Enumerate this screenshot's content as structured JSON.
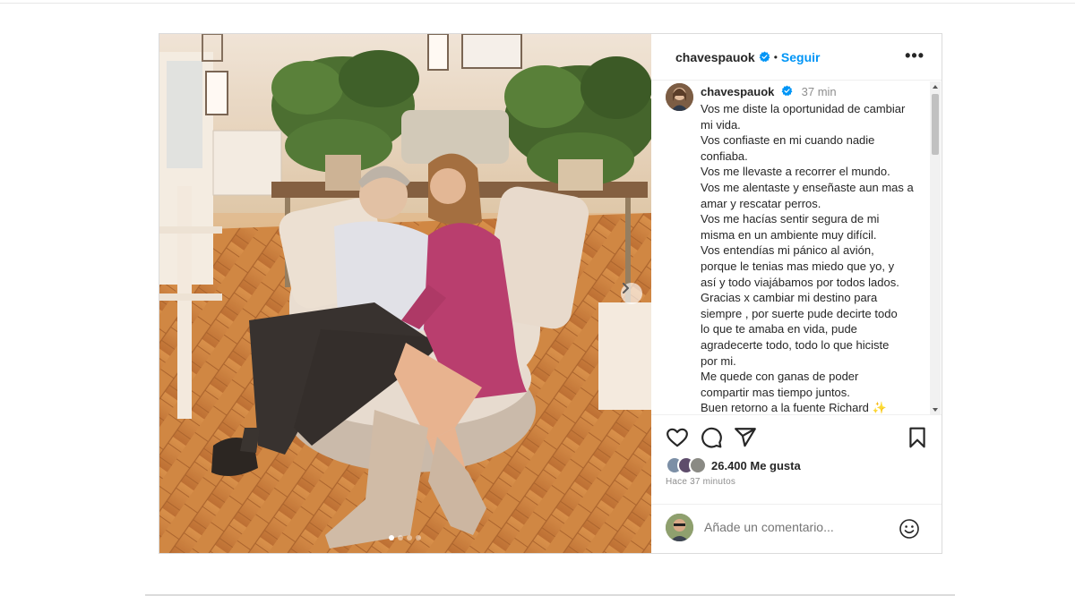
{
  "post": {
    "username": "chavespauok",
    "follow_label": "Seguir",
    "separator": "•",
    "more_label": "•••",
    "caption": {
      "username": "chavespauok",
      "time": "37 min",
      "lines": [
        "Vos me diste la oportunidad de cambiar",
        "mi vida.",
        "Vos confiaste en mi cuando nadie",
        "confiaba.",
        "Vos me llevaste a recorrer el mundo.",
        "Vos me alentaste y enseñaste aun mas a",
        "amar y rescatar perros.",
        "Vos me hacías sentir segura de mi",
        "misma en un ambiente muy difícil.",
        "Vos entendías mi pánico al avión,",
        "porque le tenias mas miedo que yo, y",
        "así y todo viajábamos por todos lados.",
        "Gracias x cambiar mi destino para",
        "siempre , por suerte pude decirte todo",
        "lo que te amaba en vida, pude",
        "agradecerte todo, todo lo que hiciste",
        "por mi.",
        "Me quede con ganas de poder",
        "compartir mas tiempo juntos.",
        "Buen retorno a la fuente Richard ✨"
      ]
    },
    "likes": "26.400 Me gusta",
    "posted_ago": "Hace 37 minutos",
    "comment_placeholder": "Añade un comentario...",
    "carousel": {
      "count": 4,
      "active_index": 0
    },
    "icons": {
      "more": "more-options-icon",
      "like": "heart-icon",
      "comment": "comment-icon",
      "share": "share-icon",
      "save": "bookmark-icon",
      "emoji": "emoji-icon",
      "next": "chevron-right-icon",
      "verified": "verified-badge-icon"
    },
    "colors": {
      "link": "#0095f6",
      "verified": "#0095f6",
      "text": "#262626",
      "muted": "#8e8e8e",
      "border": "#dbdbdb"
    }
  }
}
